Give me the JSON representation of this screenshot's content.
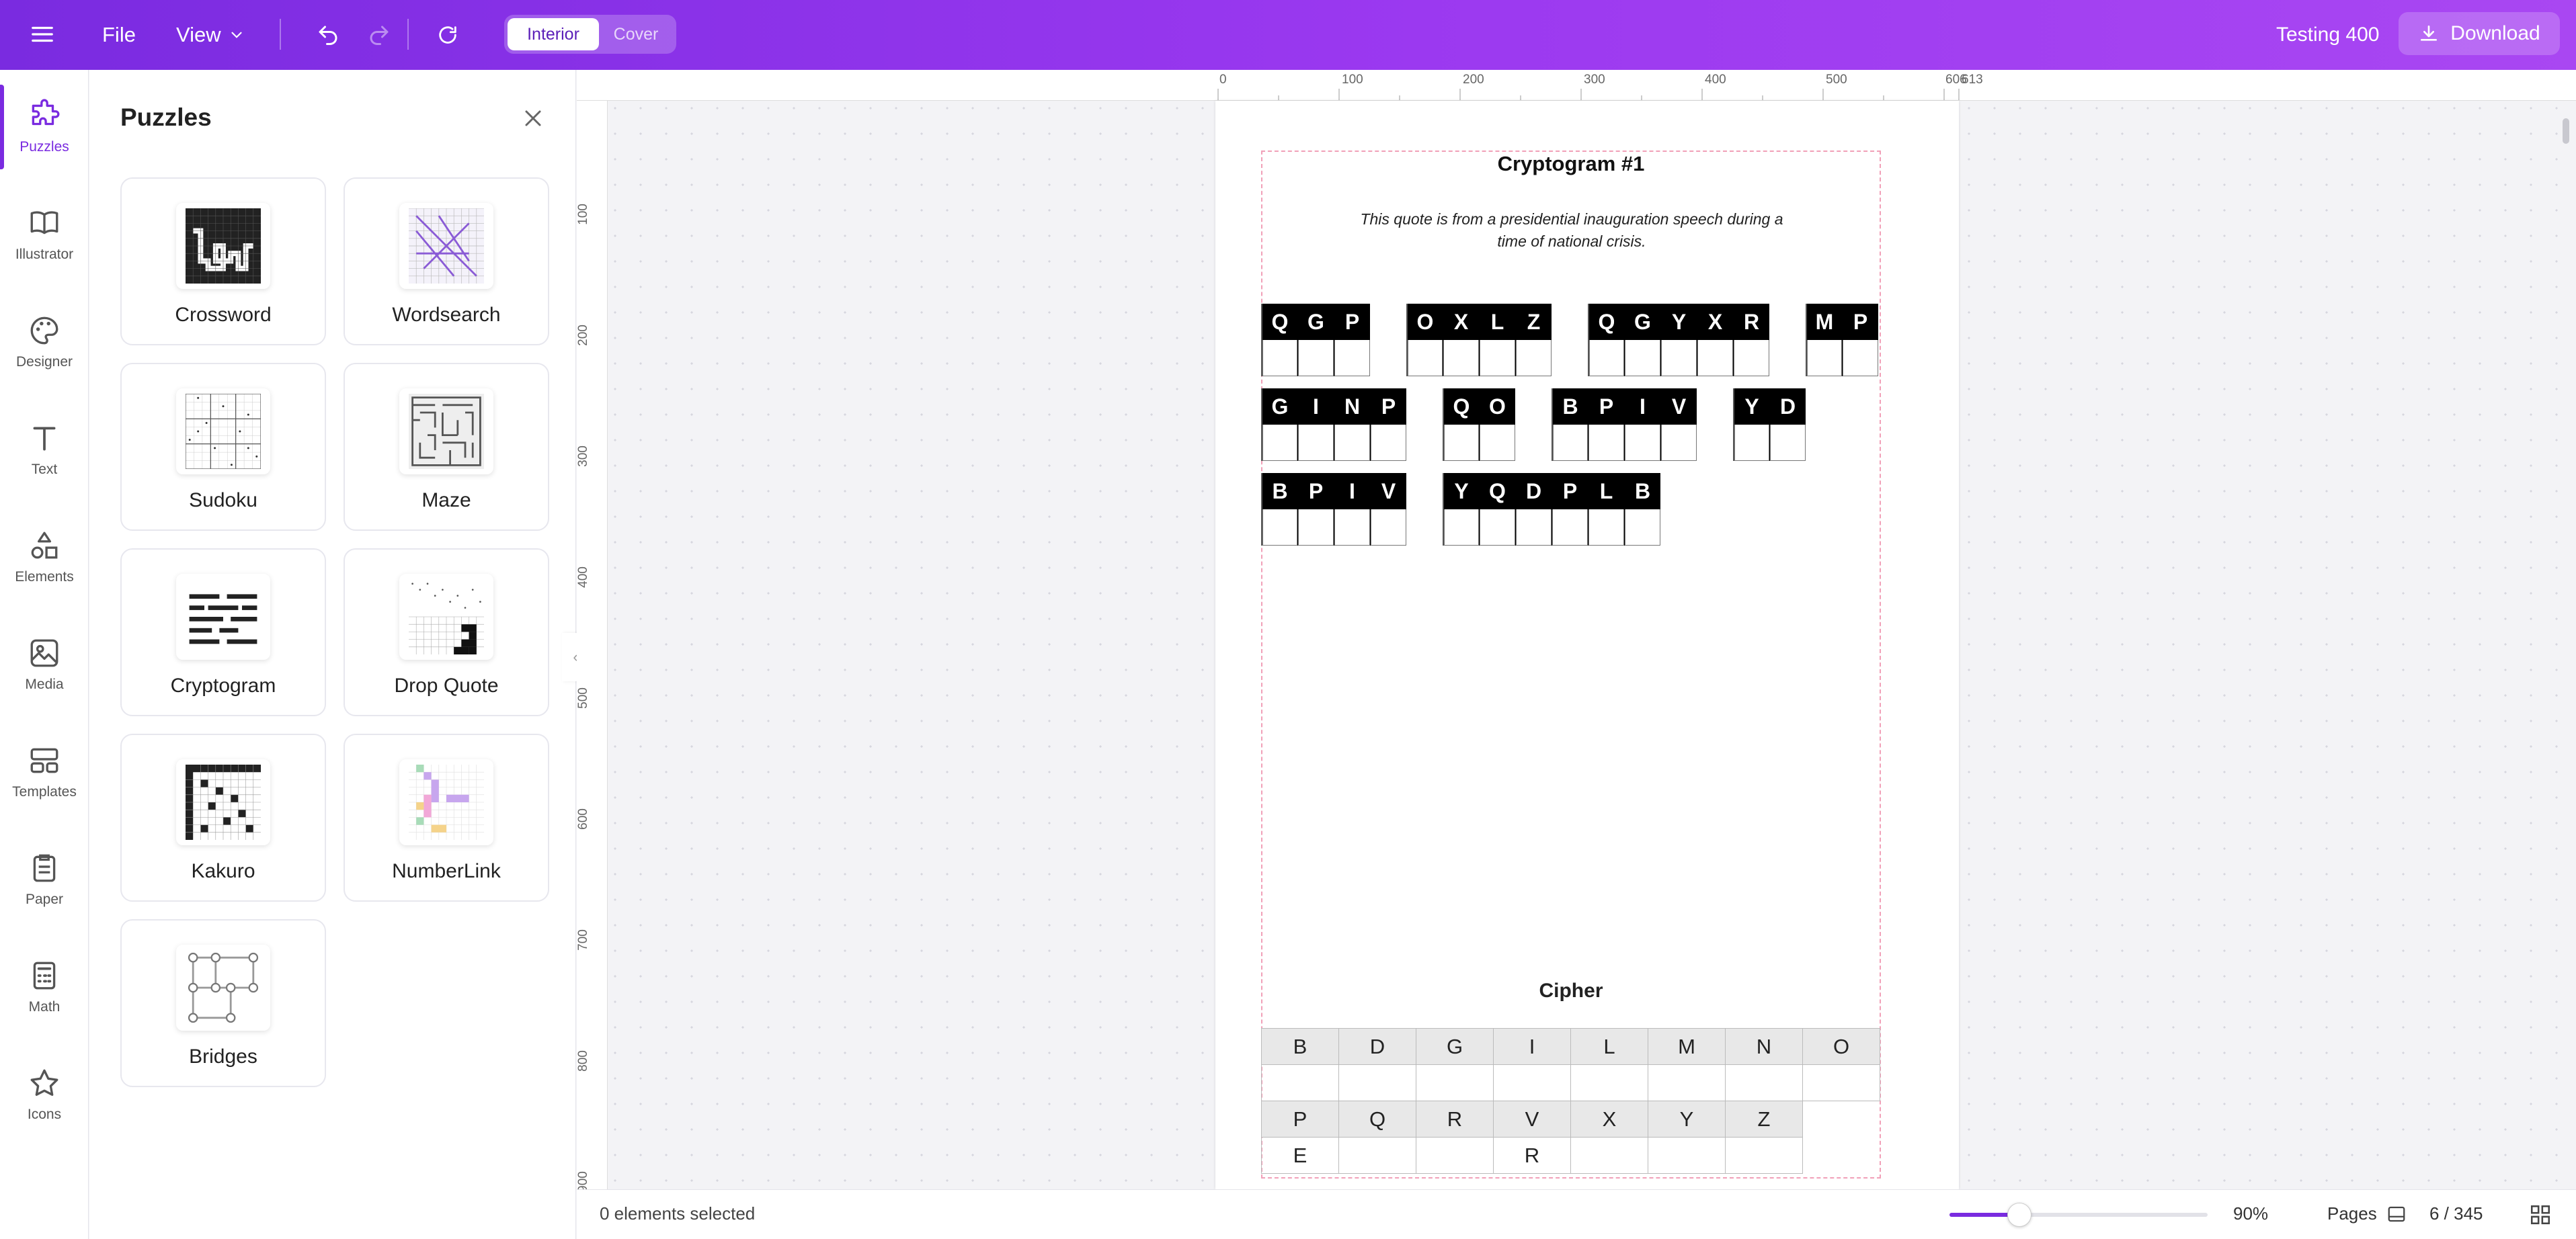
{
  "topbar": {
    "file_label": "File",
    "view_label": "View",
    "mode_interior": "Interior",
    "mode_cover": "Cover",
    "project_name": "Testing 400",
    "download_label": "Download"
  },
  "rail": {
    "items": [
      {
        "label": "Puzzles",
        "icon": "puzzle-icon",
        "active": true
      },
      {
        "label": "Illustrator",
        "icon": "book-icon"
      },
      {
        "label": "Designer",
        "icon": "palette-icon"
      },
      {
        "label": "Text",
        "icon": "text-icon"
      },
      {
        "label": "Elements",
        "icon": "shapes-icon"
      },
      {
        "label": "Media",
        "icon": "image-icon"
      },
      {
        "label": "Templates",
        "icon": "layout-icon"
      },
      {
        "label": "Paper",
        "icon": "clipboard-icon"
      },
      {
        "label": "Math",
        "icon": "calculator-icon"
      },
      {
        "label": "Icons",
        "icon": "star-icon"
      }
    ]
  },
  "panel": {
    "title": "Puzzles",
    "cards": [
      {
        "label": "Crossword"
      },
      {
        "label": "Wordsearch"
      },
      {
        "label": "Sudoku"
      },
      {
        "label": "Maze"
      },
      {
        "label": "Cryptogram"
      },
      {
        "label": "Drop Quote"
      },
      {
        "label": "Kakuro"
      },
      {
        "label": "NumberLink"
      },
      {
        "label": "Bridges"
      }
    ]
  },
  "rulers": {
    "top": [
      "0",
      "100",
      "200",
      "300",
      "400",
      "500",
      "606",
      "613"
    ],
    "left": [
      "100",
      "200",
      "300",
      "400",
      "500",
      "600",
      "700",
      "800",
      "900"
    ]
  },
  "puzzle": {
    "title": "Cryptogram #1",
    "hint": "This quote is from a presidential inauguration speech during a time of national crisis.",
    "words": [
      "QGP",
      "OXLZ",
      "QGYXR",
      "MP",
      "GINP",
      "QO",
      "BPIV",
      "YD",
      "BPIV",
      "YQDPLB"
    ],
    "cipher_title": "Cipher",
    "cipher_rows": [
      {
        "keys": [
          "B",
          "D",
          "G",
          "I",
          "L",
          "M",
          "N",
          "O"
        ],
        "vals": [
          "",
          "",
          "",
          "",
          "",
          "",
          "",
          ""
        ]
      },
      {
        "keys": [
          "P",
          "Q",
          "R",
          "V",
          "X",
          "Y",
          "Z"
        ],
        "vals": [
          "E",
          "",
          "",
          "R",
          "",
          "",
          ""
        ]
      }
    ]
  },
  "status": {
    "selection": "0 elements selected",
    "zoom": "90%",
    "zoom_fraction": 0.27,
    "pages_label": "Pages",
    "page_counter": "6 / 345"
  },
  "colors": {
    "accent": "#7a2be0",
    "topbar_end": "#a947f2",
    "margin_guide": "#f1a0b8"
  }
}
